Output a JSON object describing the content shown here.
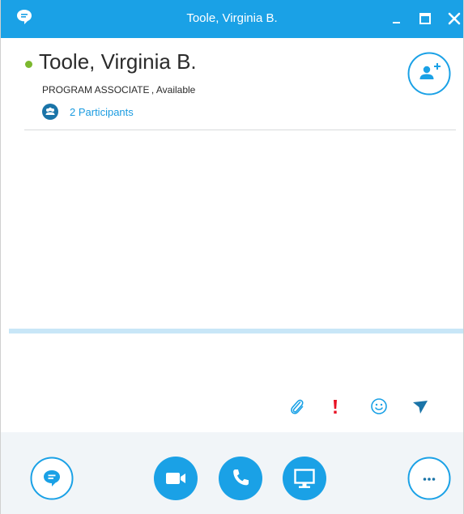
{
  "window": {
    "title": "Toole, Virginia B."
  },
  "contact": {
    "name": "Toole, Virginia B.",
    "status_line": "PROGRAM ASSOCIATE , Available",
    "presence_color": "#7cb82f"
  },
  "participants": {
    "label": "2 Participants"
  },
  "compose": {
    "placeholder": ""
  },
  "icons": {
    "app": "chat-bubble-icon",
    "add_person": "add-person-icon",
    "participants": "people-icon",
    "attach": "paperclip-icon",
    "important": "exclamation-icon",
    "emoji": "smiley-icon",
    "send": "send-arrow-icon",
    "im": "chat-bubble-icon",
    "video": "video-camera-icon",
    "call": "phone-icon",
    "share": "monitor-icon",
    "more": "ellipsis-icon"
  },
  "colors": {
    "accent": "#1aa1e6",
    "important": "#e81123",
    "action_bar_bg": "#f1f5f8",
    "divider_thick": "#c8e6f7"
  }
}
